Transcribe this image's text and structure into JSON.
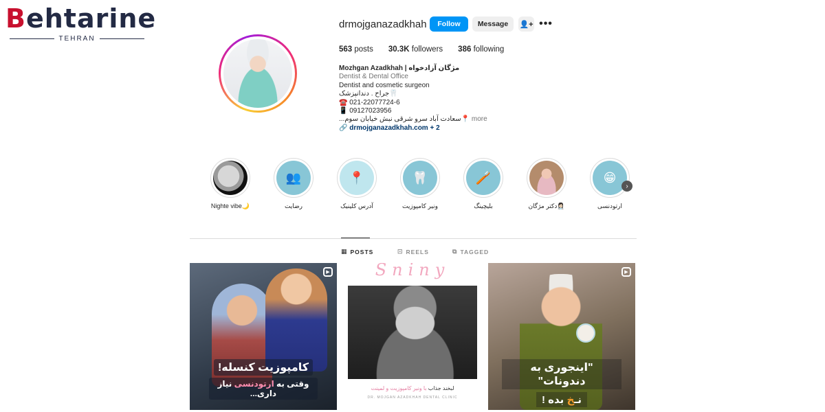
{
  "logo": {
    "word_b": "B",
    "word_rest": "ehtarine",
    "sub": "TEHRAN"
  },
  "profile": {
    "username": "drmojganazadkhah",
    "follow_label": "Follow",
    "message_label": "Message",
    "stats": {
      "posts_value": "563",
      "posts_label": "posts",
      "followers_value": "30.3K",
      "followers_label": "followers",
      "following_value": "386",
      "following_label": "following"
    },
    "bio": {
      "name": "Mozhgan Azadkhah | مژگان آزادخواه",
      "category": "Dentist & Dental Office",
      "line1": "Dentist and cosmetic surgeon",
      "line2": "🦷جراح . دندانپزشک",
      "line3": "☎️ 021-22077724-6",
      "line4": "📱 09127023956",
      "line5": "📍سعادت آباد سرو شرقی نبش خیابان سوم...",
      "more": "more",
      "link": "drmojganazadkhah.com + 2"
    }
  },
  "highlights": [
    {
      "label": "Nighte vibe🌙",
      "style": "dark",
      "icon": "moon-icon",
      "glyph": ""
    },
    {
      "label": "رضایت",
      "style": "blue",
      "icon": "people-icon",
      "glyph": "👥"
    },
    {
      "label": "آدرس کلینیک",
      "style": "pale",
      "icon": "location-pin-icon",
      "glyph": "📍"
    },
    {
      "label": "ونیر کامپوزیت",
      "style": "blue",
      "icon": "tooth-icon",
      "glyph": "🦷"
    },
    {
      "label": "بلیچینگ",
      "style": "blue",
      "icon": "toothbrush-icon",
      "glyph": "🪥"
    },
    {
      "label": "دکتر مژگان👩🏻‍⚕️",
      "style": "photo",
      "icon": "portrait-icon",
      "glyph": ""
    },
    {
      "label": "ارتودنسی",
      "style": "blue",
      "icon": "braces-icon",
      "glyph": "😁"
    }
  ],
  "tabs": [
    {
      "label": "POSTS",
      "icon": "grid-icon",
      "glyph": "▦"
    },
    {
      "label": "REELS",
      "icon": "reels-icon",
      "glyph": "⊡"
    },
    {
      "label": "TAGGED",
      "icon": "tagged-icon",
      "glyph": "⧉"
    }
  ],
  "posts": {
    "p1": {
      "line1": "کامپوزیت کنسله!",
      "line2_pre": "وقتی به ",
      "line2_hl": "ارتودنسی",
      "line2_post": " نیاز داری..."
    },
    "p2": {
      "title": "Sniny",
      "caption_pre": "لبخند جذاب ",
      "caption_hl": "با ونیر کامپوزیت و لمینت",
      "small": "DR. MOJGAN AZADKHAH DENTAL CLINIC"
    },
    "p3": {
      "line1": "\"اینجوری به دندونات\"",
      "line2_a": "نـ",
      "line2_or": "خ",
      "line2_b": " بده !"
    }
  },
  "colors": {
    "follow": "#0095f6",
    "link": "#00376b",
    "accent_pink": "#f2a8bf"
  }
}
